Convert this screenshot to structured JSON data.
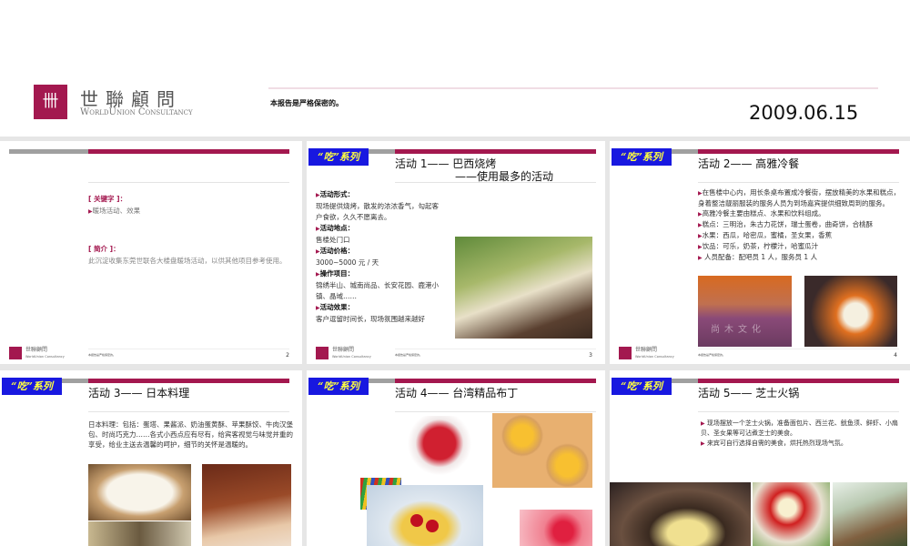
{
  "cover": {
    "logo_cn": "世聯顧問",
    "logo_en": "WorldUnion Consultancy",
    "confidential": "本报告是严格保密的。",
    "date": "2009.06.15",
    "brand_color": "#a3184f"
  },
  "badge": "“吃”系列",
  "footer": {
    "logo_cn": "世聯顧問",
    "logo_en": "WorldUnion Consultancy",
    "note": "本报告是严格保密的。"
  },
  "slides": [
    {
      "page": "2",
      "keyword_label": "[ 关键字 ]：",
      "keyword": "暖场活动、效果",
      "intro_label": "[ 简介 ]：",
      "intro": "此沉淀收集东莞世联各大楼盘暖场活动，以供其他项目参考使用。"
    },
    {
      "page": "3",
      "title": "活动 1—— 巴西烧烤",
      "subtitle": "——使用最多的活动",
      "items": [
        {
          "h": "活动形式：",
          "t": "现场提供烧烤，散发的浓浓香气，勾起客户食欲，久久不愿离去。"
        },
        {
          "h": "活动地点：",
          "t": "售楼处门口"
        },
        {
          "h": "活动价格：",
          "t": "3000~5000 元 / 天"
        },
        {
          "h": "操作项目：",
          "t": "锦绣半山、城南尚品、长安花园、鹿港小镇、晶域……"
        },
        {
          "h": "活动效果：",
          "t": "客户逗留时间长，现场氛围越来越好"
        }
      ]
    },
    {
      "page": "4",
      "title": "活动 2—— 高雅冷餐",
      "items": [
        "在售楼中心内，用长条桌布置成冷餐街，摆放精美的水果和糕点，身着整洁靓丽服装的服务人员为到场嘉宾提供细致周到的服务。",
        "高雅冷餐主要由糕点、水果和饮料组成。",
        "糕点：三明治，朱古力花饼，瑞士蛋卷，曲奇饼，合桃酥",
        "水果：西瓜，哈密瓜，蜜橘，圣女果，香蕉",
        "饮品：可乐，奶茶，柠檬汁，哈蜜瓜汁",
        " 人员配备：配吧员 1 人，服务员 1 人"
      ],
      "watermark": "尚木文化"
    },
    {
      "title": "活动 3—— 日本料理",
      "text": "日本料理：包括：蛋塔、果酱派、奶油蛋黄酥、苹果酥饺、牛肉汉堡包、时尚巧克力……各式小西点应有尽有，给宾客视觉与味觉并重的享受，给业主送去温馨的呵护，细节的关怀是温暖的。"
    },
    {
      "title": "活动 4—— 台湾精品布丁"
    },
    {
      "title": "活动 5—— 芝士火锅",
      "items": [
        "现场摆放一个芝士火锅，准备面包片、西兰花、鱿鱼须、鲜虾、小扇贝、圣女果等可沾煮芝士的美食。",
        "来宾可自行选择自需的美食，烘托热烈现场气氛。"
      ]
    }
  ]
}
